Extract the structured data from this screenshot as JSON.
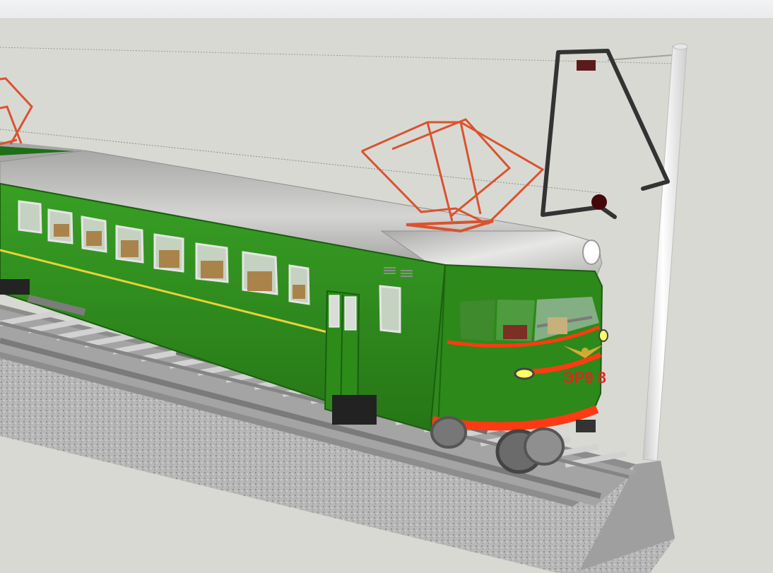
{
  "window": {
    "title": ""
  },
  "scene": {
    "model": "electric-train-3d",
    "train_number": "ЭР9 8",
    "colors": {
      "background": "#d9d9d3",
      "body_green": "#2f8d1c",
      "body_green_dark": "#1f6b12",
      "roof_gray": "#b8b8b6",
      "accent_red": "#ff3a12",
      "pantograph": "#d9532e",
      "yellow_stripe": "#e8d33a",
      "window_glass": "#c9d8cc",
      "catenary_pole": "#f2f2f2",
      "gravel": "#b7b7b7"
    },
    "icons": {
      "pantograph": "pantograph-icon",
      "headlight": "headlight-icon",
      "catenary": "catenary-icon"
    }
  }
}
